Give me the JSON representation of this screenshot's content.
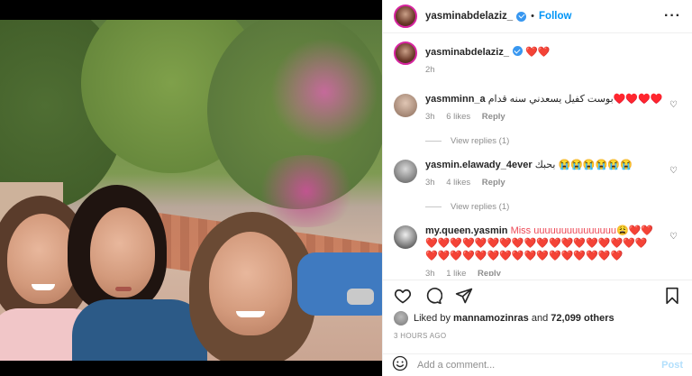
{
  "header": {
    "username": "yasminabdelaziz_",
    "dot": "•",
    "follow_label": "Follow",
    "more_icon": "more-horizontal-icon"
  },
  "caption": {
    "username": "yasminabdelaziz_",
    "text": "❤️❤️",
    "time": "2h"
  },
  "comments": [
    {
      "username": "yasmminn_a",
      "text": "بوست كفيل يسعدني سنه قدام♥️♥️♥️♥️",
      "time": "3h",
      "likes": "6 likes",
      "reply": "Reply",
      "view_replies": "View replies (1)"
    },
    {
      "username": "yasmin.elawady_4ever",
      "text": "بحبك 😭😭😭😭😭😭",
      "time": "3h",
      "likes": "4 likes",
      "reply": "Reply",
      "view_replies": "View replies (1)"
    },
    {
      "username": "my.queen.yasmin",
      "text": "Miss uuuuuuuuuuuuuuu😩❤️❤️❤️❤️❤️❤️❤️❤️❤️❤️❤️❤️❤️❤️❤️❤️❤️❤️❤️❤️❤️❤️❤️❤️❤️❤️❤️❤️❤️❤️❤️❤️❤️❤️❤️❤️",
      "time": "3h",
      "likes": "1 like",
      "reply": "Reply"
    }
  ],
  "likes": {
    "prefix": "Liked by ",
    "user": "mannamozinras",
    "middle": " and ",
    "count": "72,099 others"
  },
  "timestamp": "3 HOURS AGO",
  "add_comment": {
    "placeholder": "Add a comment...",
    "post_label": "Post"
  },
  "colors": {
    "follow": "#0095f6",
    "verified": "#3897f0",
    "heart": "#ed4956"
  }
}
